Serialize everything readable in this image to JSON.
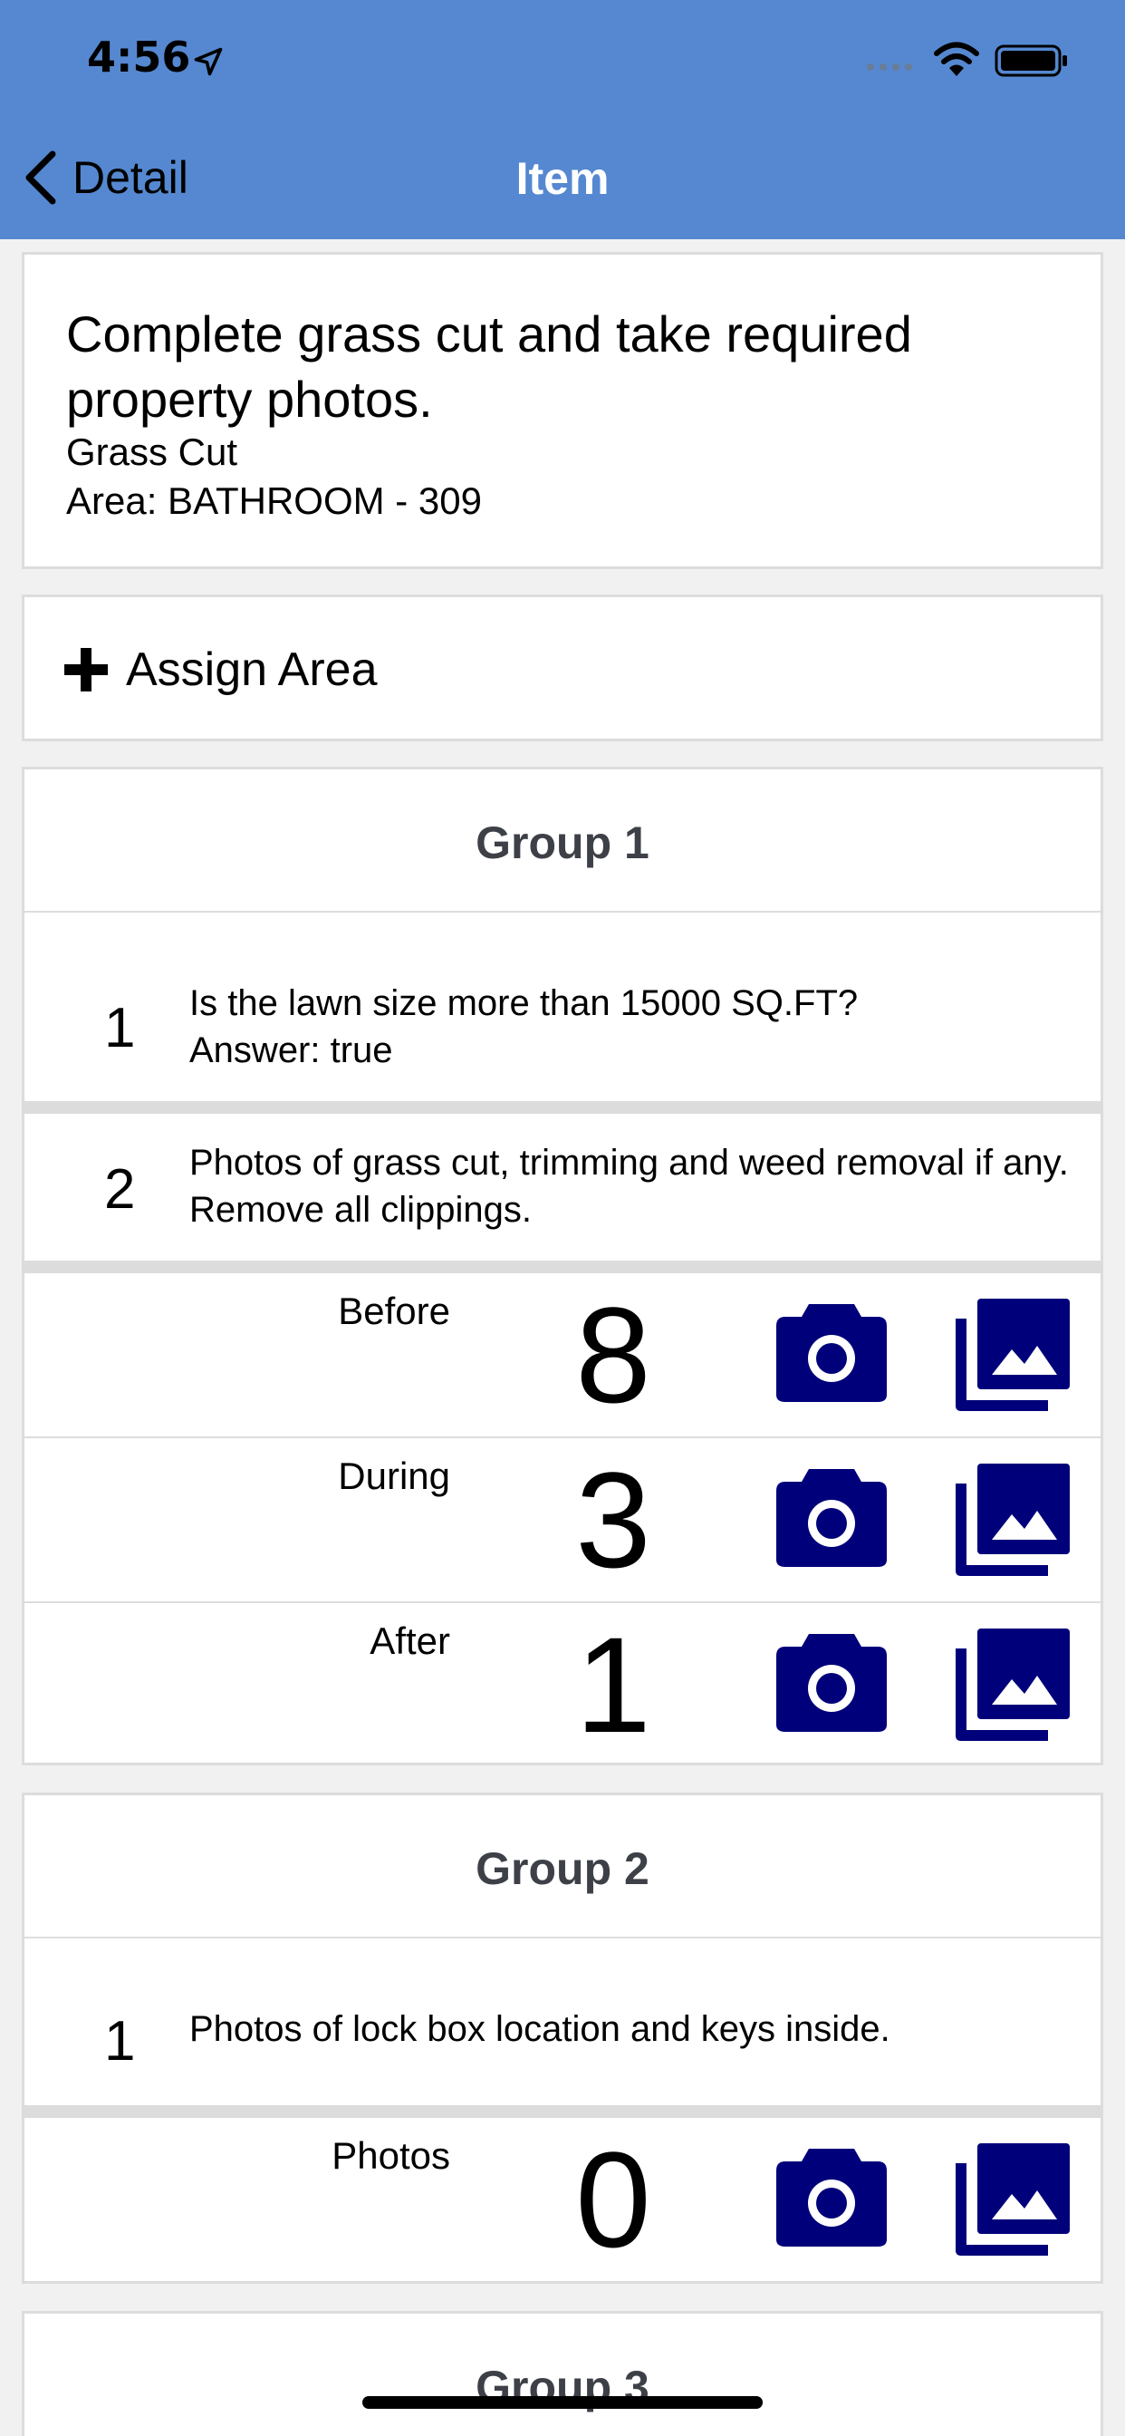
{
  "status_bar": {
    "time": "4:56"
  },
  "nav": {
    "back_label": "Detail",
    "title": "Item"
  },
  "description": {
    "title": "Complete grass cut and take required property photos.",
    "subtitle": "Grass Cut",
    "area": "Area: BATHROOM - 309"
  },
  "assign_area": {
    "label": "Assign Area"
  },
  "groups": [
    {
      "title": "Group 1",
      "questions": [
        {
          "number": "1",
          "text": "Is the lawn size more than 15000 SQ.FT?",
          "answer": "Answer: true"
        },
        {
          "number": "2",
          "text": "Photos of grass cut, trimming and weed removal if any. Remove all clippings."
        }
      ],
      "photos": [
        {
          "label": "Before",
          "count": "8"
        },
        {
          "label": "During",
          "count": "3"
        },
        {
          "label": "After",
          "count": "1"
        }
      ]
    },
    {
      "title": "Group 2",
      "questions": [
        {
          "number": "1",
          "text": "Photos of lock box location and keys inside."
        }
      ],
      "photos": [
        {
          "label": "Photos",
          "count": "0"
        }
      ]
    },
    {
      "title": "Group 3"
    }
  ],
  "icons": {
    "back": "chevron-left-icon",
    "plus": "plus-icon",
    "camera": "camera-icon",
    "gallery": "photo-library-icon"
  },
  "colors": {
    "nav_background": "#5588d0",
    "icon_color": "#00007a",
    "page_background": "#f1f1f1"
  }
}
